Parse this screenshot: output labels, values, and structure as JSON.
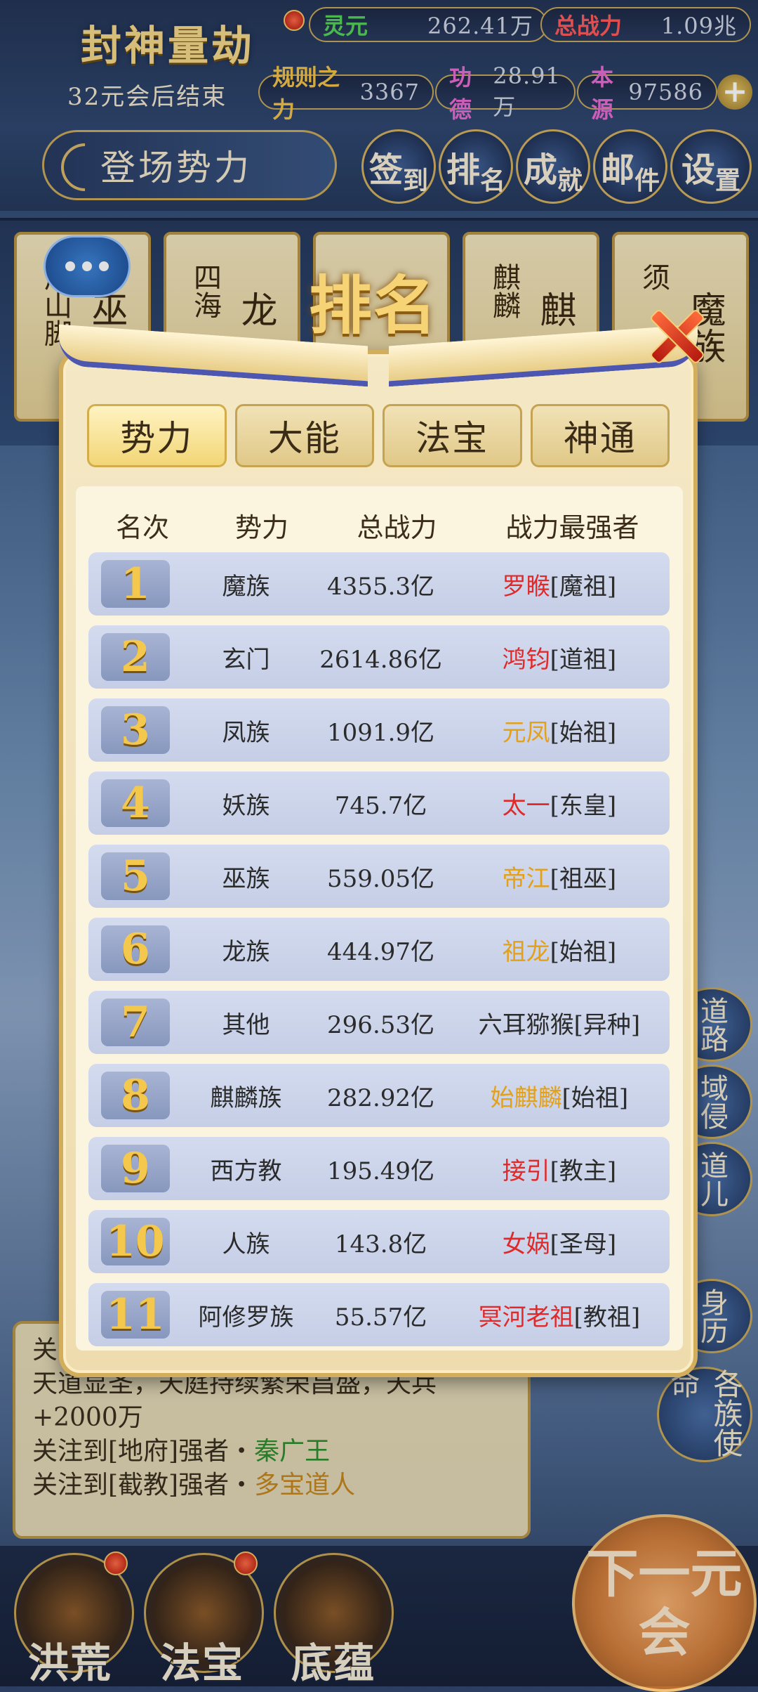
{
  "hud": {
    "title": "封神量劫",
    "subtitle": "32元会后结束",
    "stats": [
      {
        "label": "灵元",
        "value": "262.41万",
        "color": "#55d25a"
      },
      {
        "label": "总战力",
        "value": "1.09兆",
        "color": "#ff5a5a"
      },
      {
        "label": "规则之力",
        "value": "3367",
        "color": "#f1c24a"
      },
      {
        "label": "功德",
        "value": "28.91万",
        "color": "#e86bd3"
      },
      {
        "label": "本源",
        "value": "97586",
        "color": "#e86bd3"
      }
    ],
    "powers_button": "登场势力",
    "top_buttons": [
      {
        "big": "签",
        "small": "到"
      },
      {
        "big": "排",
        "small": "名"
      },
      {
        "big": "成",
        "small": "就"
      },
      {
        "big": "邮",
        "small": "件"
      },
      {
        "big": "设",
        "small": "置"
      }
    ]
  },
  "faction_cards": [
    {
      "a": "周山脚",
      "b": "巫"
    },
    {
      "a": "四海",
      "b": "龙"
    },
    {
      "a": "",
      "b": ""
    },
    {
      "a": "麒麟",
      "b": "麒"
    },
    {
      "a": "须",
      "b": "魔族"
    }
  ],
  "modal": {
    "title": "排名",
    "tabs": [
      "势力",
      "大能",
      "法宝",
      "神通"
    ],
    "headers": [
      "名次",
      "势力",
      "总战力",
      "战力最强者"
    ],
    "rows": [
      {
        "rank": "1",
        "faction": "魔族",
        "power": "4355.3亿",
        "leader": "罗睺",
        "leader_title": "[魔祖]",
        "leader_color": "red"
      },
      {
        "rank": "2",
        "faction": "玄门",
        "power": "2614.86亿",
        "leader": "鸿钧",
        "leader_title": "[道祖]",
        "leader_color": "red"
      },
      {
        "rank": "3",
        "faction": "凤族",
        "power": "1091.9亿",
        "leader": "元凤",
        "leader_title": "[始祖]",
        "leader_color": "gold"
      },
      {
        "rank": "4",
        "faction": "妖族",
        "power": "745.7亿",
        "leader": "太一",
        "leader_title": "[东皇]",
        "leader_color": "red"
      },
      {
        "rank": "5",
        "faction": "巫族",
        "power": "559.05亿",
        "leader": "帝江",
        "leader_title": "[祖巫]",
        "leader_color": "gold"
      },
      {
        "rank": "6",
        "faction": "龙族",
        "power": "444.97亿",
        "leader": "祖龙",
        "leader_title": "[始祖]",
        "leader_color": "gold"
      },
      {
        "rank": "7",
        "faction": "其他",
        "power": "296.53亿",
        "leader": "六耳猕猴",
        "leader_title": "[异种]",
        "leader_color": "none"
      },
      {
        "rank": "8",
        "faction": "麒麟族",
        "power": "282.92亿",
        "leader": "始麒麟",
        "leader_title": "[始祖]",
        "leader_color": "gold"
      },
      {
        "rank": "9",
        "faction": "西方教",
        "power": "195.49亿",
        "leader": "接引",
        "leader_title": "[教主]",
        "leader_color": "red"
      },
      {
        "rank": "10",
        "faction": "人族",
        "power": "143.8亿",
        "leader": "女娲",
        "leader_title": "[圣母]",
        "leader_color": "red"
      },
      {
        "rank": "11",
        "faction": "阿修罗族",
        "power": "55.57亿",
        "leader": "冥河老祖",
        "leader_title": "[教祖]",
        "leader_color": "red"
      }
    ]
  },
  "side_buttons": [
    "道路",
    "域侵",
    "道儿",
    "身历",
    "各族使命"
  ],
  "news": {
    "line0": "关注",
    "line1": "天道显圣，天庭持续繁荣昌盛，天兵+2000万",
    "line2_prefix": "关注到[地府]强者・",
    "line2_name": "秦广王",
    "line3_prefix": "关注到[截教]强者・",
    "line3_name": "多宝道人"
  },
  "bottom": {
    "buttons": [
      "洪荒",
      "法宝",
      "底蕴"
    ],
    "next_label": "下一元会"
  }
}
